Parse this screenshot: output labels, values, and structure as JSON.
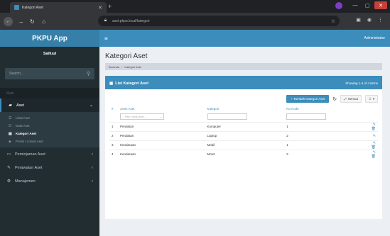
{
  "browser": {
    "tab_title": "Kategori Aset",
    "address": "aset.pkpu.local/kategori",
    "close_glyph": "✕"
  },
  "sidebar": {
    "logo": "PKPU App",
    "user_name": "Saifuul",
    "search_placeholder": "Search...",
    "header": "Main",
    "menu": [
      {
        "label": "Aset",
        "icon": "briefcase-icon",
        "open": true
      },
      {
        "label": "Peminjaman Aset",
        "icon": "laptop-icon"
      },
      {
        "label": "Perawatan Aset",
        "icon": "wrench-icon"
      },
      {
        "label": "Manajemen",
        "icon": "settings-icon"
      }
    ],
    "submenu": [
      {
        "label": "Lihat Aset",
        "icon": "list-icon"
      },
      {
        "label": "Data Aset",
        "icon": "database-icon"
      },
      {
        "label": "Kategori Aset",
        "icon": "tags-icon",
        "active": true
      },
      {
        "label": "Posisi / Lokasi Aset",
        "icon": "map-icon"
      }
    ]
  },
  "topbar": {
    "user": "Administrator"
  },
  "page": {
    "title": "Kategori Aset",
    "breadcrumb": [
      "Beranda",
      "Kategori Aset"
    ]
  },
  "box": {
    "title": "List Kategori Aset",
    "info": "Showing 1-4 of 4 items"
  },
  "toolbar": {
    "add_label": "+ Tambah Kategori Aset",
    "export_label": "Semua",
    "refresh_icon": "refresh-icon"
  },
  "table": {
    "headers": [
      "#",
      "Jenis Aset",
      "Kategori",
      "No Kode",
      ""
    ],
    "filter_placeholder": "-- Pilih Jenis Aset --",
    "rows": [
      {
        "no": "1",
        "jenis": "Peralatan",
        "kategori": "Komputer",
        "kode": "1"
      },
      {
        "no": "2",
        "jenis": "Peralatan",
        "kategori": "Laptop",
        "kode": "2"
      },
      {
        "no": "3",
        "jenis": "Kendaraan",
        "kategori": "Mobil",
        "kode": "1"
      },
      {
        "no": "4",
        "jenis": "Kendaraan",
        "kategori": "Motor",
        "kode": "2"
      }
    ]
  },
  "colors": {
    "accent": "#3c8dbc",
    "sidebar": "#222d32",
    "logo": "#367fa9"
  }
}
